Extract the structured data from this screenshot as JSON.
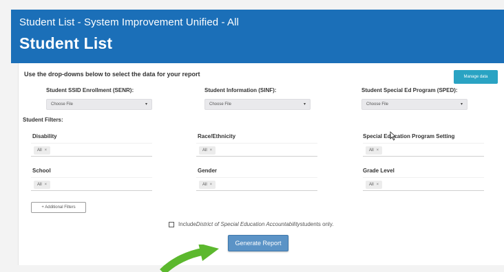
{
  "header": {
    "subtitle": "Student List - System Improvement Unified - All",
    "title": "Student List"
  },
  "report": {
    "instructions": "Use the drop-downs below to select the data for your report",
    "manage_data_label": "Manage data"
  },
  "sources": [
    {
      "label": "Student SSID Enrollment (SENR):",
      "value": "Choose File"
    },
    {
      "label": "Student Information (SINF):",
      "value": "Choose File"
    },
    {
      "label": "Student Special Ed Program (SPED):",
      "value": "Choose File"
    }
  ],
  "filters": {
    "heading": "Student Filters:",
    "items": [
      {
        "label": "Disability",
        "tag": "All"
      },
      {
        "label": "Race/Ethnicity",
        "tag": "All"
      },
      {
        "label": "Special Education Program Setting",
        "tag": "All"
      },
      {
        "label": "School",
        "tag": "All"
      },
      {
        "label": "Gender",
        "tag": "All"
      },
      {
        "label": "Grade Level",
        "tag": "All"
      }
    ],
    "remove_symbol": "×",
    "additional_filters_label": "+ Additional Filters"
  },
  "options": {
    "include_prefix": "Include ",
    "include_emphasis": "District of Special Education Accountability",
    "include_suffix": " students only."
  },
  "actions": {
    "generate_label": "Generate Report"
  },
  "colors": {
    "header_bg": "#1b6fb8",
    "manage_btn": "#2aa3c3",
    "generate_btn": "#5b93c6",
    "arrow": "#5cb82e"
  },
  "icons": {
    "dropdown": "caret-down-icon",
    "cursor": "mouse-pointer-icon",
    "annotation": "curved-arrow-icon"
  }
}
